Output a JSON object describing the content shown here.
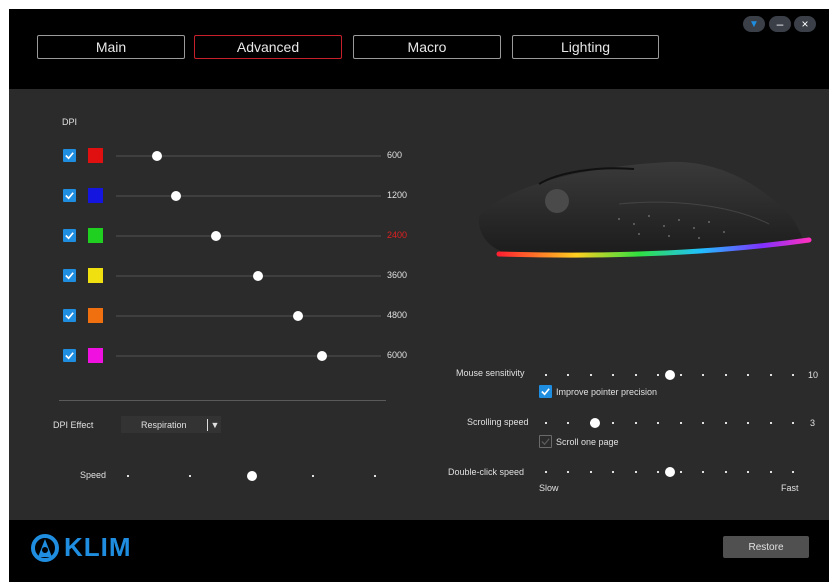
{
  "tabs": [
    {
      "label": "Main",
      "active": false
    },
    {
      "label": "Advanced",
      "active": true
    },
    {
      "label": "Macro",
      "active": false
    },
    {
      "label": "Lighting",
      "active": false
    }
  ],
  "window_controls": {
    "dropdown": "▼",
    "minimize": "–",
    "close": "×"
  },
  "dpi": {
    "title": "DPI",
    "levels": [
      {
        "checked": true,
        "color": "#e01010",
        "value": "600",
        "level": 0.08,
        "selected": false
      },
      {
        "checked": true,
        "color": "#1515e0",
        "value": "1200",
        "level": 0.15,
        "selected": false
      },
      {
        "checked": true,
        "color": "#20d020",
        "value": "2400",
        "level": 0.3,
        "selected": true
      },
      {
        "checked": true,
        "color": "#f0e010",
        "value": "3600",
        "level": 0.46,
        "selected": false
      },
      {
        "checked": true,
        "color": "#f07010",
        "value": "4800",
        "level": 0.61,
        "selected": false
      },
      {
        "checked": true,
        "color": "#f010e0",
        "value": "6000",
        "level": 0.7,
        "selected": false
      }
    ],
    "selected_color": "#e02020"
  },
  "dpi_effect": {
    "label": "DPI Effect",
    "value": "Respiration",
    "arrow": "▼"
  },
  "speed": {
    "label": "Speed",
    "level": 0.5
  },
  "mouse_sensitivity": {
    "label": "Mouse sensitivity",
    "value": "10",
    "level": 0.5
  },
  "improve_precision": {
    "label": "Improve pointer precision",
    "checked": true
  },
  "scrolling_speed": {
    "label": "Scrolling speed",
    "value": "3",
    "level": 0.2
  },
  "scroll_one_page": {
    "label": "Scroll one page",
    "checked": false
  },
  "double_click_speed": {
    "label": "Double-click speed",
    "min_label": "Slow",
    "max_label": "Fast",
    "level": 0.5
  },
  "restore_button": {
    "label": "Restore"
  },
  "brand": {
    "name": "KLIM",
    "color": "#1f8de0"
  }
}
